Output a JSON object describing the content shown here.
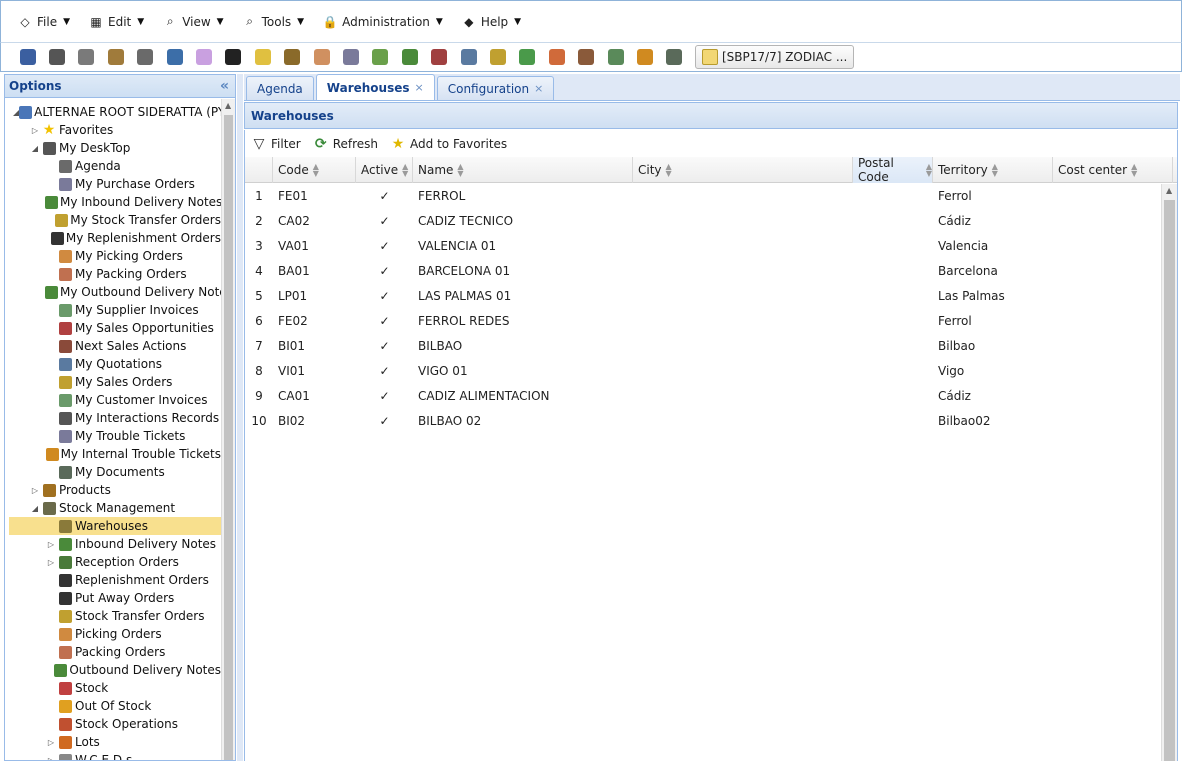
{
  "menu": [
    {
      "label": "File",
      "icon": "file-icon"
    },
    {
      "label": "Edit",
      "icon": "edit-icon"
    },
    {
      "label": "View",
      "icon": "view-icon"
    },
    {
      "label": "Tools",
      "icon": "tools-icon"
    },
    {
      "label": "Administration",
      "icon": "lock-icon"
    },
    {
      "label": "Help",
      "icon": "help-icon"
    }
  ],
  "toolbar": {
    "buttons": [
      "print-icon",
      "cut-icon",
      "copy-icon",
      "paste-icon",
      "calendar-icon",
      "database-icon",
      "box-icon",
      "users-icon",
      "folder-icon",
      "truck-icon",
      "package-icon",
      "invoice-icon",
      "delivery-icon",
      "delivery-out-icon",
      "person-icon",
      "calculator-icon",
      "sales-icon",
      "supplier-invoice-icon",
      "home-icon",
      "contact-icon",
      "document-icon",
      "bug-icon",
      "archive-icon"
    ],
    "colors": [
      "#3b5fa0",
      "#555555",
      "#7a7a7a",
      "#a07b3b",
      "#6a6a6a",
      "#3c6ea8",
      "#c9a0e0",
      "#222222",
      "#e0c040",
      "#8a6a2a",
      "#d09060",
      "#7a7a9a",
      "#6aa04a",
      "#4a8a3a",
      "#a04040",
      "#5a7aa0",
      "#c0a030",
      "#4a9a4a",
      "#d06a3a",
      "#8a5a3a",
      "#5a8a5a",
      "#d08a20",
      "#5a6a5a"
    ],
    "session_label": "[SBP17/7] ZODIAC ..."
  },
  "left": {
    "title": "Options",
    "tree": [
      {
        "level": 0,
        "toggle": "open",
        "icon": "root-icon",
        "label": "ALTERNAE ROOT SIDERATTA (PY",
        "color": "#4a76b8"
      },
      {
        "level": 1,
        "toggle": "closed",
        "icon": "star-icon",
        "label": "Favorites",
        "color": "#f2c200"
      },
      {
        "level": 1,
        "toggle": "open",
        "icon": "desktop-icon",
        "label": "My DeskTop",
        "color": "#555555"
      },
      {
        "level": 2,
        "toggle": "none",
        "icon": "agenda-icon",
        "label": "Agenda",
        "color": "#6a6a6a"
      },
      {
        "level": 2,
        "toggle": "none",
        "icon": "purchase-icon",
        "label": "My Purchase Orders",
        "color": "#7a7a9a"
      },
      {
        "level": 2,
        "toggle": "none",
        "icon": "inbound-icon",
        "label": "My Inbound Delivery Notes",
        "color": "#4a8a3a"
      },
      {
        "level": 2,
        "toggle": "none",
        "icon": "transfer-icon",
        "label": "My Stock Transfer Orders",
        "color": "#c0a030"
      },
      {
        "level": 2,
        "toggle": "none",
        "icon": "replenish-icon",
        "label": "My Replenishment Orders",
        "color": "#333333"
      },
      {
        "level": 2,
        "toggle": "none",
        "icon": "picking-icon",
        "label": "My Picking Orders",
        "color": "#d08a40"
      },
      {
        "level": 2,
        "toggle": "none",
        "icon": "packing-icon",
        "label": "My Packing Orders",
        "color": "#c07050"
      },
      {
        "level": 2,
        "toggle": "none",
        "icon": "outbound-icon",
        "label": "My Outbound Delivery Note",
        "color": "#4a8a3a"
      },
      {
        "level": 2,
        "toggle": "none",
        "icon": "supplier-invoice-icon",
        "label": "My Supplier Invoices",
        "color": "#6a9a6a"
      },
      {
        "level": 2,
        "toggle": "none",
        "icon": "opportunity-icon",
        "label": "My Sales Opportunities",
        "color": "#b04040"
      },
      {
        "level": 2,
        "toggle": "none",
        "icon": "actions-icon",
        "label": "Next Sales Actions",
        "color": "#8a4a3a"
      },
      {
        "level": 2,
        "toggle": "none",
        "icon": "calculator-icon",
        "label": "My Quotations",
        "color": "#5a7aa0"
      },
      {
        "level": 2,
        "toggle": "none",
        "icon": "sales-icon",
        "label": "My Sales Orders",
        "color": "#c0a030"
      },
      {
        "level": 2,
        "toggle": "none",
        "icon": "customer-invoice-icon",
        "label": "My Customer Invoices",
        "color": "#6a9a6a"
      },
      {
        "level": 2,
        "toggle": "none",
        "icon": "interaction-icon",
        "label": "My Interactions Records",
        "color": "#555555"
      },
      {
        "level": 2,
        "toggle": "none",
        "icon": "ticket-icon",
        "label": "My Trouble Tickets",
        "color": "#7a7a9a"
      },
      {
        "level": 2,
        "toggle": "none",
        "icon": "bug-icon",
        "label": "My Internal Trouble Tickets",
        "color": "#d08a20"
      },
      {
        "level": 2,
        "toggle": "none",
        "icon": "documents-icon",
        "label": "My Documents",
        "color": "#5a6a5a"
      },
      {
        "level": 1,
        "toggle": "closed",
        "icon": "products-icon",
        "label": "Products",
        "color": "#a07020"
      },
      {
        "level": 1,
        "toggle": "open",
        "icon": "stock-management-icon",
        "label": "Stock Management",
        "color": "#6a6a4a"
      },
      {
        "level": 2,
        "toggle": "none",
        "icon": "warehouse-icon",
        "label": "Warehouses",
        "color": "#8a7a3a",
        "selected": true
      },
      {
        "level": 2,
        "toggle": "closed",
        "icon": "inbound-icon",
        "label": "Inbound Delivery Notes",
        "color": "#4a8a3a"
      },
      {
        "level": 2,
        "toggle": "closed",
        "icon": "reception-icon",
        "label": "Reception Orders",
        "color": "#4a7a3a"
      },
      {
        "level": 2,
        "toggle": "none",
        "icon": "replenish-icon",
        "label": "Replenishment Orders",
        "color": "#333333"
      },
      {
        "level": 2,
        "toggle": "none",
        "icon": "putaway-icon",
        "label": "Put Away Orders",
        "color": "#333333"
      },
      {
        "level": 2,
        "toggle": "none",
        "icon": "transfer-icon",
        "label": "Stock Transfer Orders",
        "color": "#c0a030"
      },
      {
        "level": 2,
        "toggle": "none",
        "icon": "picking-icon",
        "label": "Picking Orders",
        "color": "#d08a40"
      },
      {
        "level": 2,
        "toggle": "none",
        "icon": "packing-icon",
        "label": "Packing Orders",
        "color": "#c07050"
      },
      {
        "level": 2,
        "toggle": "none",
        "icon": "outbound-icon",
        "label": "Outbound Delivery Notes",
        "color": "#4a8a3a"
      },
      {
        "level": 2,
        "toggle": "none",
        "icon": "stock-icon",
        "label": "Stock",
        "color": "#c04040"
      },
      {
        "level": 2,
        "toggle": "none",
        "icon": "out-of-stock-icon",
        "label": "Out Of Stock",
        "color": "#e0a020"
      },
      {
        "level": 2,
        "toggle": "none",
        "icon": "stock-operations-icon",
        "label": "Stock Operations",
        "color": "#c05030"
      },
      {
        "level": 2,
        "toggle": "closed",
        "icon": "lots-icon",
        "label": "Lots",
        "color": "#d06a20"
      },
      {
        "level": 2,
        "toggle": "closed",
        "icon": "wced-icon",
        "label": "W.C.E.D.s",
        "color": "#888888"
      }
    ]
  },
  "tabs": [
    {
      "label": "Agenda",
      "active": false,
      "closable": false
    },
    {
      "label": "Warehouses",
      "active": true,
      "closable": true
    },
    {
      "label": "Configuration",
      "active": false,
      "closable": true
    }
  ],
  "panel": {
    "title": "Warehouses",
    "actions": [
      {
        "label": "Filter",
        "icon": "filter-icon"
      },
      {
        "label": "Refresh",
        "icon": "refresh-icon"
      },
      {
        "label": "Add to Favorites",
        "icon": "add-favorite-icon"
      }
    ]
  },
  "grid": {
    "columns": [
      {
        "key": "code",
        "label": "Code",
        "sorted": false
      },
      {
        "key": "active",
        "label": "Active",
        "sorted": false
      },
      {
        "key": "name",
        "label": "Name",
        "sorted": false
      },
      {
        "key": "city",
        "label": "City",
        "sorted": false
      },
      {
        "key": "postal",
        "label": "Postal Code",
        "sorted": true
      },
      {
        "key": "territory",
        "label": "Territory",
        "sorted": false
      },
      {
        "key": "cost",
        "label": "Cost center",
        "sorted": false
      }
    ],
    "rows": [
      {
        "n": "1",
        "code": "FE01",
        "active": "✓",
        "name": "FERROL",
        "city": "",
        "postal": "",
        "territory": "Ferrol",
        "cost": ""
      },
      {
        "n": "2",
        "code": "CA02",
        "active": "✓",
        "name": "CADIZ TECNICO",
        "city": "",
        "postal": "",
        "territory": "Cádiz",
        "cost": ""
      },
      {
        "n": "3",
        "code": "VA01",
        "active": "✓",
        "name": "VALENCIA 01",
        "city": "",
        "postal": "",
        "territory": "Valencia",
        "cost": ""
      },
      {
        "n": "4",
        "code": "BA01",
        "active": "✓",
        "name": "BARCELONA 01",
        "city": "",
        "postal": "",
        "territory": "Barcelona",
        "cost": ""
      },
      {
        "n": "5",
        "code": "LP01",
        "active": "✓",
        "name": "LAS PALMAS 01",
        "city": "",
        "postal": "",
        "territory": "Las Palmas",
        "cost": ""
      },
      {
        "n": "6",
        "code": "FE02",
        "active": "✓",
        "name": "FERROL REDES",
        "city": "",
        "postal": "",
        "territory": "Ferrol",
        "cost": ""
      },
      {
        "n": "7",
        "code": "BI01",
        "active": "✓",
        "name": "BILBAO",
        "city": "",
        "postal": "",
        "territory": "Bilbao",
        "cost": ""
      },
      {
        "n": "8",
        "code": "VI01",
        "active": "✓",
        "name": "VIGO 01",
        "city": "",
        "postal": "",
        "territory": "Vigo",
        "cost": ""
      },
      {
        "n": "9",
        "code": "CA01",
        "active": "✓",
        "name": "CADIZ ALIMENTACION",
        "city": "",
        "postal": "",
        "territory": "Cádiz",
        "cost": ""
      },
      {
        "n": "10",
        "code": "BI02",
        "active": "✓",
        "name": "BILBAO 02",
        "city": "",
        "postal": "",
        "territory": "Bilbao02",
        "cost": ""
      }
    ]
  }
}
